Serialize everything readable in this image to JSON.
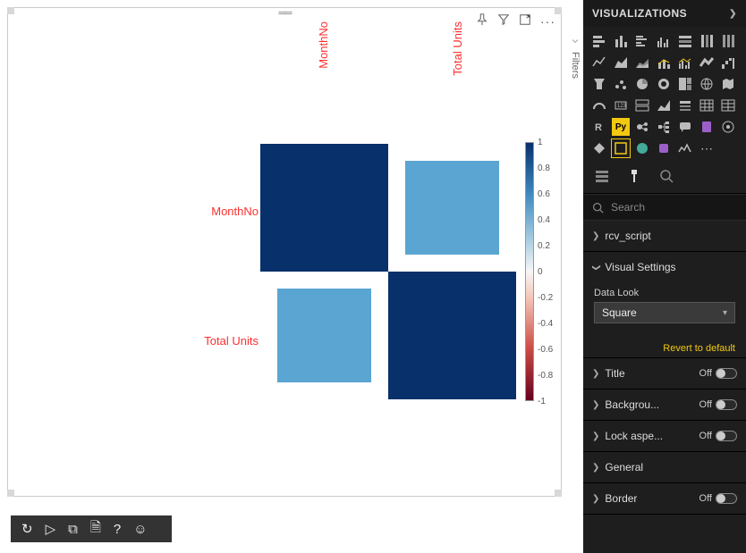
{
  "panel": {
    "title": "VISUALIZATIONS",
    "filters_label": "Filters"
  },
  "search": {
    "placeholder": "Search"
  },
  "sections": {
    "rcv": {
      "label": "rcv_script"
    },
    "visual_settings": {
      "label": "Visual Settings",
      "field_label": "Data Look",
      "dropdown_value": "Square",
      "revert": "Revert to default"
    },
    "title": {
      "label": "Title",
      "toggle": "Off"
    },
    "background": {
      "label": "Backgrou...",
      "toggle": "Off"
    },
    "lockaspect": {
      "label": "Lock aspe...",
      "toggle": "Off"
    },
    "general": {
      "label": "General"
    },
    "border": {
      "label": "Border",
      "toggle": "Off"
    }
  },
  "chart_data": {
    "type": "heatmap",
    "labels": [
      "MonthNo",
      "Total Units"
    ],
    "matrix": [
      [
        1.0,
        0.6
      ],
      [
        0.6,
        1.0
      ]
    ],
    "colorbar_ticks": [
      "1",
      "0.8",
      "0.6",
      "0.4",
      "0.2",
      "0",
      "-0.2",
      "-0.4",
      "-0.6",
      "-0.8",
      "-1"
    ]
  }
}
